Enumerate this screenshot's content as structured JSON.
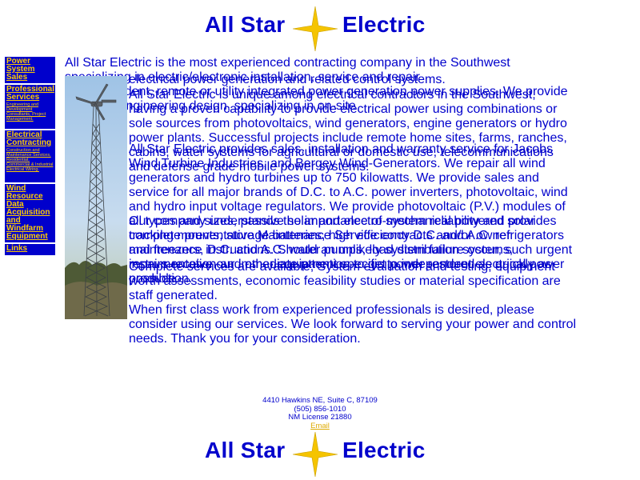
{
  "brand": {
    "word1": "All Star",
    "word2": "Electric",
    "icon": "four-point-star-icon",
    "star_color": "#f5c400"
  },
  "nav": {
    "items": [
      {
        "label": "Power System Sales",
        "desc": ""
      },
      {
        "label": "Professional Services",
        "desc": "Engineering and Development Consultants, Project Management."
      },
      {
        "label": "Electrical Contracting",
        "desc": "Construction and Maintenance Services, Residential, Commercial & Industrial Electrical Wiring."
      },
      {
        "label": "Wind Resource Data Acquisition and Windfarm Equipment",
        "desc": ""
      },
      {
        "label": "Links",
        "desc": ""
      }
    ]
  },
  "content": {
    "intro_first_line": "All Star Electric is the most experienced contracting company in the Southwest specializing in electric/electronic installation, service and repair",
    "intro_second_line": "of independent, remote or utility integrated power generation power supplies. We provide electrical engineering design, specializing in on-site",
    "intro_rest": "electrical power generation and related control systems.",
    "p2": "All Star Electric is unique among electrical contractors in the Southwest, having a proven capability to provide electrical power using combinations or sole sources from photovoltaics, wind generators, engine generators or hydro power plants. Successful projects include remote home sites, farms, ranches, cabins, water systems for agricultural or domestic use, telecommunications and defense grade mobile power systems.",
    "p3": "All Star Electric provides sales, installation and warranty service for Jacobs Wind Turbine Industries, and Bergey Wind-Generators. We repair all wind generators and hydro turbines up to 750 kilowatts. We provide sales and service for all major brands of D.C. to A.C. power inverters, photovoltaic, wind and hydro input voltage regulators. We provide photovoltaic (P.V.) modules of all types and sizes, passive solar and electro-mechanical powered solar tracking mounts, storage batteries, high efficiency D.C. and A.C. refrigerators and freezers, D.C. and A.C. water pumps, load distribution systems, instrumentation and other equipment specific to independent electrical power production.",
    "p4": "Our company understands the importance of system reliability and provides complete preventative Maintenance Service contracts and/or owner maintenance instructions. Should an unlikely system failure occur, such urgent repairs receive our immediate attention to get power restored as quickly as possible.",
    "p5a": "Complete services are available; System evaluation and testing, equipment worth assessments, economic feasibility studies or material specification are staff generated.",
    "p5b": "When first class work from experienced professionals is desired, please consider using our services. We look forward to serving your power and control needs. Thank you for your consideration."
  },
  "footer": {
    "address": "4410 Hawkins NE, Suite C, 87109",
    "phone": "(505) 856-1010",
    "license": "NM License 21880",
    "email_label": "Email"
  }
}
